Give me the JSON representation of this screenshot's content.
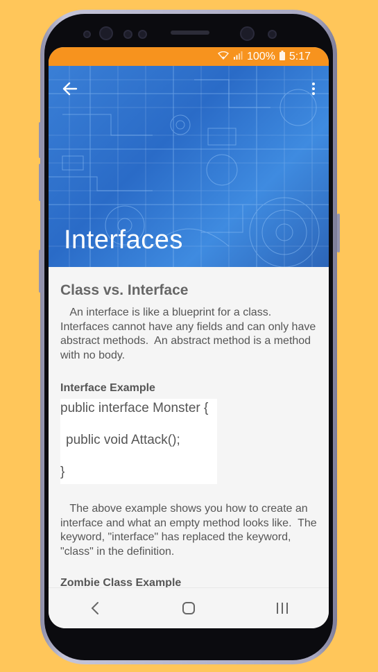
{
  "status_bar": {
    "battery": "100%",
    "time": "5:17",
    "icons": [
      "wifi-icon",
      "signal-icon",
      "battery-icon"
    ]
  },
  "header": {
    "title": "Interfaces",
    "back_icon": "arrow-back-icon",
    "menu_icon": "more-vert-icon"
  },
  "content": {
    "section_title": "Class vs. Interface",
    "intro": "   An interface is like a blueprint for a class. Interfaces cannot have any fields and can only have abstract methods.  An abstract method is a method with no body.",
    "example_heading": "Interface Example",
    "code_lines": [
      "public interface Monster {",
      " public void Attack();",
      "}"
    ],
    "explanation": "   The above example shows you how to create an interface and what an empty method looks like.  The keyword, \"interface\" has replaced the keyword, \"class\" in the definition.",
    "zombie_heading": "Zombie Class Example"
  },
  "nav_bar": {
    "buttons": [
      "back-nav-icon",
      "home-nav-icon",
      "recents-nav-icon"
    ]
  },
  "colors": {
    "page_background": "#FFC65A",
    "status_bar": "#F7931E",
    "header_blue": "#2f75d0"
  }
}
